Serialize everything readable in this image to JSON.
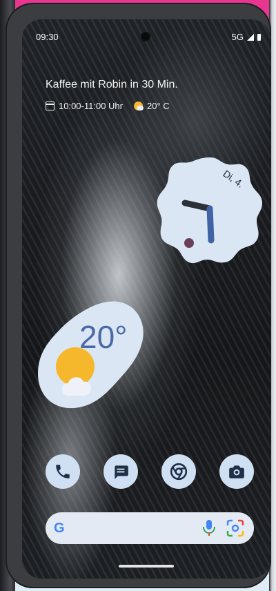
{
  "statusbar": {
    "time": "09:30",
    "network": "5G"
  },
  "glance": {
    "event": "Kaffee mit Robin in 30 Min.",
    "time_range": "10:00-11:00 Uhr",
    "weather": "20° C"
  },
  "clock_widget": {
    "date": "Di, 4."
  },
  "weather_widget": {
    "temperature": "20°"
  },
  "dock": {
    "apps": [
      "phone",
      "messages",
      "chrome",
      "camera"
    ]
  },
  "search": {
    "logo": "G"
  },
  "colors": {
    "widget_bg": "#dbe6f4",
    "accent_blue": "#4a6aa6",
    "clock_hand_dark": "#2b2f36",
    "clock_hand_blue": "#3f63a4",
    "clock_dot": "#6a3f57"
  }
}
